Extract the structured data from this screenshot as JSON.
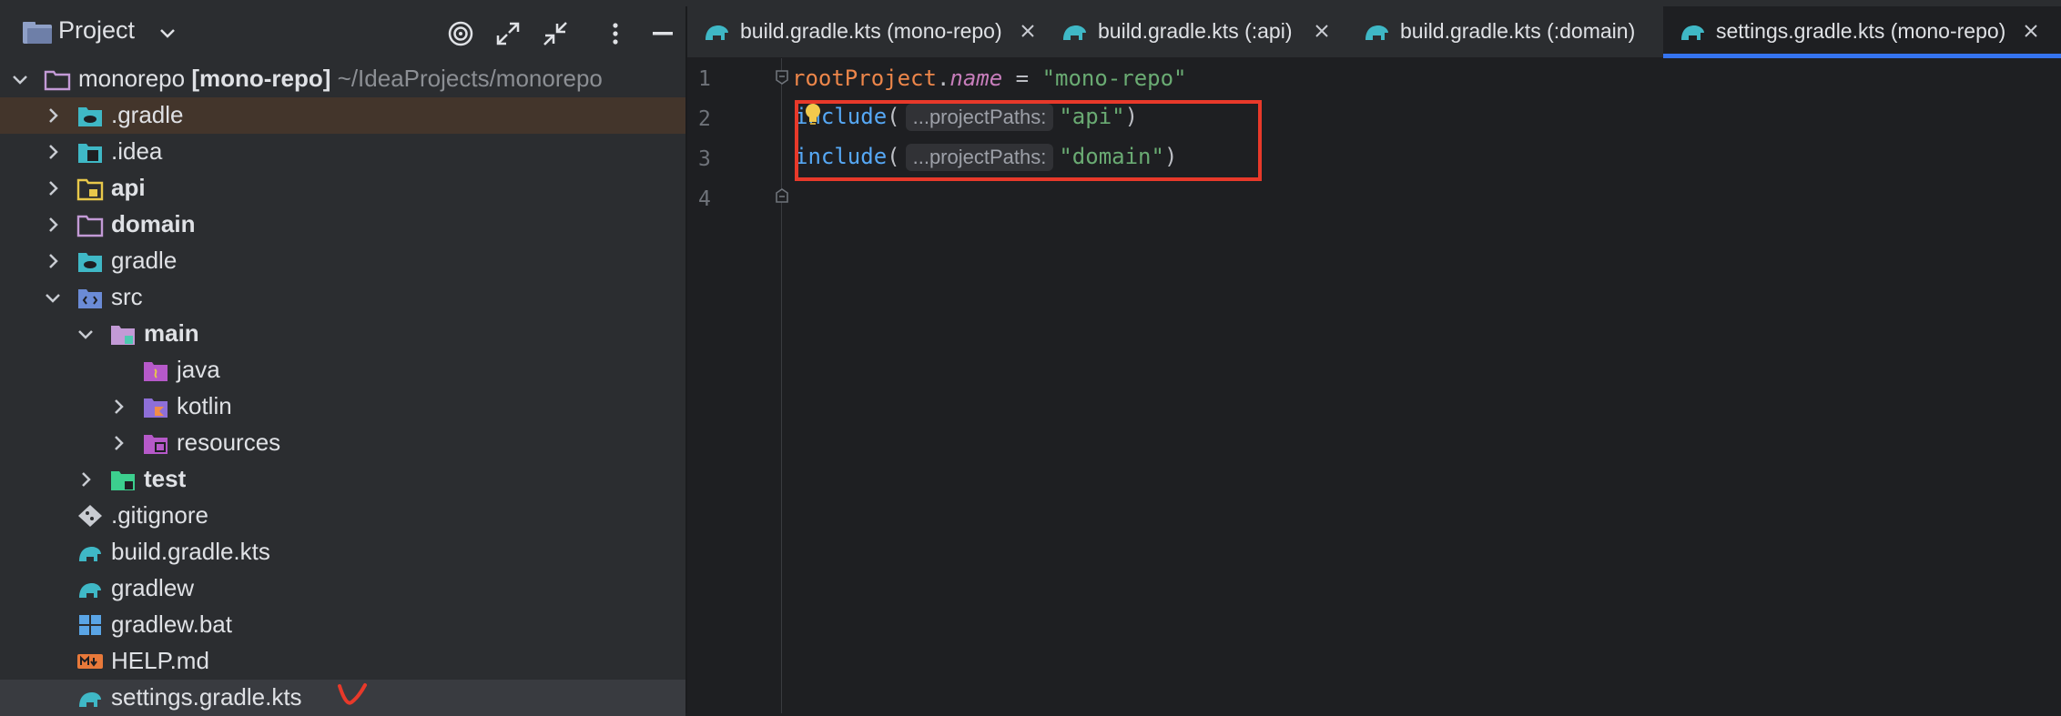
{
  "panel": {
    "title": "Project",
    "tree": [
      {
        "name": "monorepo",
        "project_tag": "[mono-repo]",
        "path": "~/IdeaProjects/monorepo",
        "expanded": true
      },
      {
        "name": ".gradle"
      },
      {
        "name": ".idea"
      },
      {
        "name": "api"
      },
      {
        "name": "domain"
      },
      {
        "name": "gradle"
      },
      {
        "name": "src"
      },
      {
        "name": "main"
      },
      {
        "name": "java"
      },
      {
        "name": "kotlin"
      },
      {
        "name": "resources"
      },
      {
        "name": "test"
      },
      {
        "name": ".gitignore"
      },
      {
        "name": "build.gradle.kts"
      },
      {
        "name": "gradlew"
      },
      {
        "name": "gradlew.bat"
      },
      {
        "name": "HELP.md"
      },
      {
        "name": "settings.gradle.kts"
      }
    ]
  },
  "tabs": [
    {
      "label": "build.gradle.kts (mono-repo)",
      "active": false
    },
    {
      "label": "build.gradle.kts (:api)",
      "active": false
    },
    {
      "label": "build.gradle.kts (:domain)",
      "active": false
    },
    {
      "label": "settings.gradle.kts (mono-repo)",
      "active": true
    }
  ],
  "editor": {
    "line_numbers": [
      "1",
      "2",
      "3",
      "4"
    ],
    "line1": {
      "root": "rootProject",
      "dot": ".",
      "prop": "name",
      "eq": " = ",
      "value": "\"mono-repo\""
    },
    "line2": {
      "fn": "include",
      "open": "(",
      "hint": "...projectPaths:",
      "arg": "\"api\"",
      "close": ")"
    },
    "line3": {
      "fn": "include",
      "open": "(",
      "hint": "...projectPaths:",
      "arg": "\"domain\"",
      "close": ")"
    }
  },
  "colors": {
    "accent": "#3574f0",
    "highlight_box": "#e8392a",
    "annotation": "#e8392a"
  }
}
